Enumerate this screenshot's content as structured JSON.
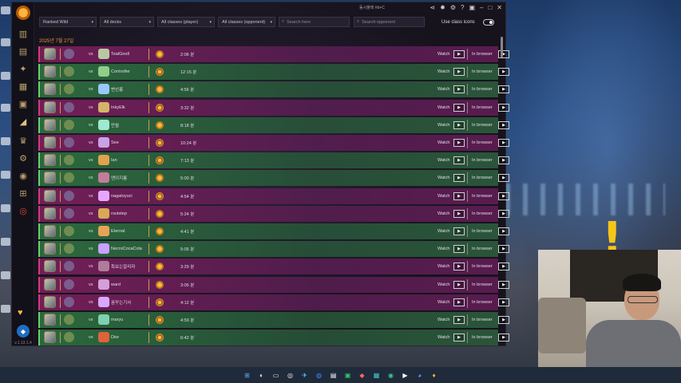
{
  "app": {
    "version": "v.1.13.1.4",
    "username": "동시플레 #b+C"
  },
  "filters": {
    "game_mode": "Ranked Wild",
    "decks": "All decks",
    "player_classes": "All classes (player)",
    "opponent_classes": "All classes (opponent)",
    "search_here_placeholder": "Search here",
    "search_opponent_placeholder": "Search opponent",
    "class_icons_label": "Use class icons",
    "class_icons_on": true
  },
  "date_header": "2025년 7월 27일",
  "row_labels": {
    "vs": "vs",
    "watch": "Watch",
    "in_browser": "In browser",
    "play_glyph": "▶"
  },
  "games": [
    {
      "result": "loss",
      "opponent": "TealGnoll",
      "duration": "2:06 분",
      "coin": "first"
    },
    {
      "result": "win",
      "opponent": "Controller",
      "duration": "12:15 분",
      "coin": "second"
    },
    {
      "result": "win",
      "opponent": "변선릉",
      "duration": "4:56 분",
      "coin": "first"
    },
    {
      "result": "loss",
      "opponent": "InkyElk",
      "duration": "3:32 분",
      "coin": "second"
    },
    {
      "result": "win",
      "opponent": "만월",
      "duration": "8:18 분",
      "coin": "first"
    },
    {
      "result": "loss",
      "opponent": "See",
      "duration": "10:24 분",
      "coin": "second"
    },
    {
      "result": "win",
      "opponent": "Ian",
      "duration": "7:13 분",
      "coin": "second"
    },
    {
      "result": "win",
      "opponent": "맨이지롱",
      "duration": "5:00 분",
      "coin": "first"
    },
    {
      "result": "loss",
      "opponent": "nagatoyuci",
      "duration": "4:54 분",
      "coin": "second"
    },
    {
      "result": "loss",
      "opponent": "routstep",
      "duration": "5:24 분",
      "coin": "first"
    },
    {
      "result": "win",
      "opponent": "Eternal",
      "duration": "4:41 분",
      "coin": "first"
    },
    {
      "result": "win",
      "opponent": "NecroCocaCola",
      "duration": "5:05 분",
      "coin": "first"
    },
    {
      "result": "loss",
      "opponent": "특보는알리자",
      "duration": "3:29 분",
      "coin": "first"
    },
    {
      "result": "loss",
      "opponent": "ward",
      "duration": "3:05 분",
      "coin": "first"
    },
    {
      "result": "loss",
      "opponent": "꿈꾸는기사",
      "duration": "4:12 분",
      "coin": "second"
    },
    {
      "result": "win",
      "opponent": "maryu",
      "duration": "4:59 분",
      "coin": "second"
    },
    {
      "result": "win",
      "opponent": "Dior",
      "duration": "6:42 분",
      "coin": "second"
    }
  ],
  "colors": {
    "win": "#2c6e3e",
    "loss": "#781e5a",
    "accent": "#e09a3a"
  }
}
